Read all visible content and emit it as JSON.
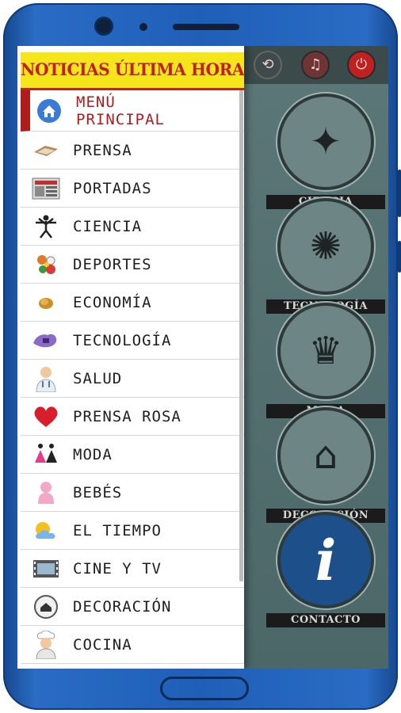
{
  "header": {
    "title": "NOTICIAS ÚLTIMA HORA"
  },
  "menu": [
    {
      "label": "MENÚ PRINCIPAL",
      "icon": "home-icon",
      "active": true
    },
    {
      "label": "PRENSA",
      "icon": "newspaper-icon"
    },
    {
      "label": "PORTADAS",
      "icon": "front-pages-icon"
    },
    {
      "label": "CIENCIA",
      "icon": "vitruvian-man-icon"
    },
    {
      "label": "DEPORTES",
      "icon": "sports-balls-icon"
    },
    {
      "label": "ECONOMÍA",
      "icon": "coins-icon"
    },
    {
      "label": "TECNOLOGÍA",
      "icon": "technology-icon"
    },
    {
      "label": "SALUD",
      "icon": "doctor-icon"
    },
    {
      "label": "PRENSA ROSA",
      "icon": "heart-icon"
    },
    {
      "label": "MODA",
      "icon": "fashion-icon"
    },
    {
      "label": "BEBÉS",
      "icon": "baby-icon"
    },
    {
      "label": "EL TIEMPO",
      "icon": "weather-icon"
    },
    {
      "label": "CINE Y TV",
      "icon": "film-icon"
    },
    {
      "label": "DECORACIÓN",
      "icon": "decoration-icon"
    },
    {
      "label": "COCINA",
      "icon": "chef-icon"
    }
  ],
  "topbar": {
    "icons": [
      "share-icon",
      "bell-icon",
      "power-icon"
    ]
  },
  "tiles": [
    {
      "label": "CIENCIA",
      "icon": "vitruvian-man-icon"
    },
    {
      "label": "TECNOLOGÍA",
      "icon": "technology-icon"
    },
    {
      "label": "MODA",
      "icon": "fashion-icon"
    },
    {
      "label": "DECORACIÓN",
      "icon": "house-icon"
    },
    {
      "label": "CONTACTO",
      "icon": "info-icon"
    }
  ],
  "colors": {
    "header_bg": "#f4e61a",
    "header_text": "#c02020",
    "active": "#b01c1c",
    "phone": "#1f5fb8"
  }
}
